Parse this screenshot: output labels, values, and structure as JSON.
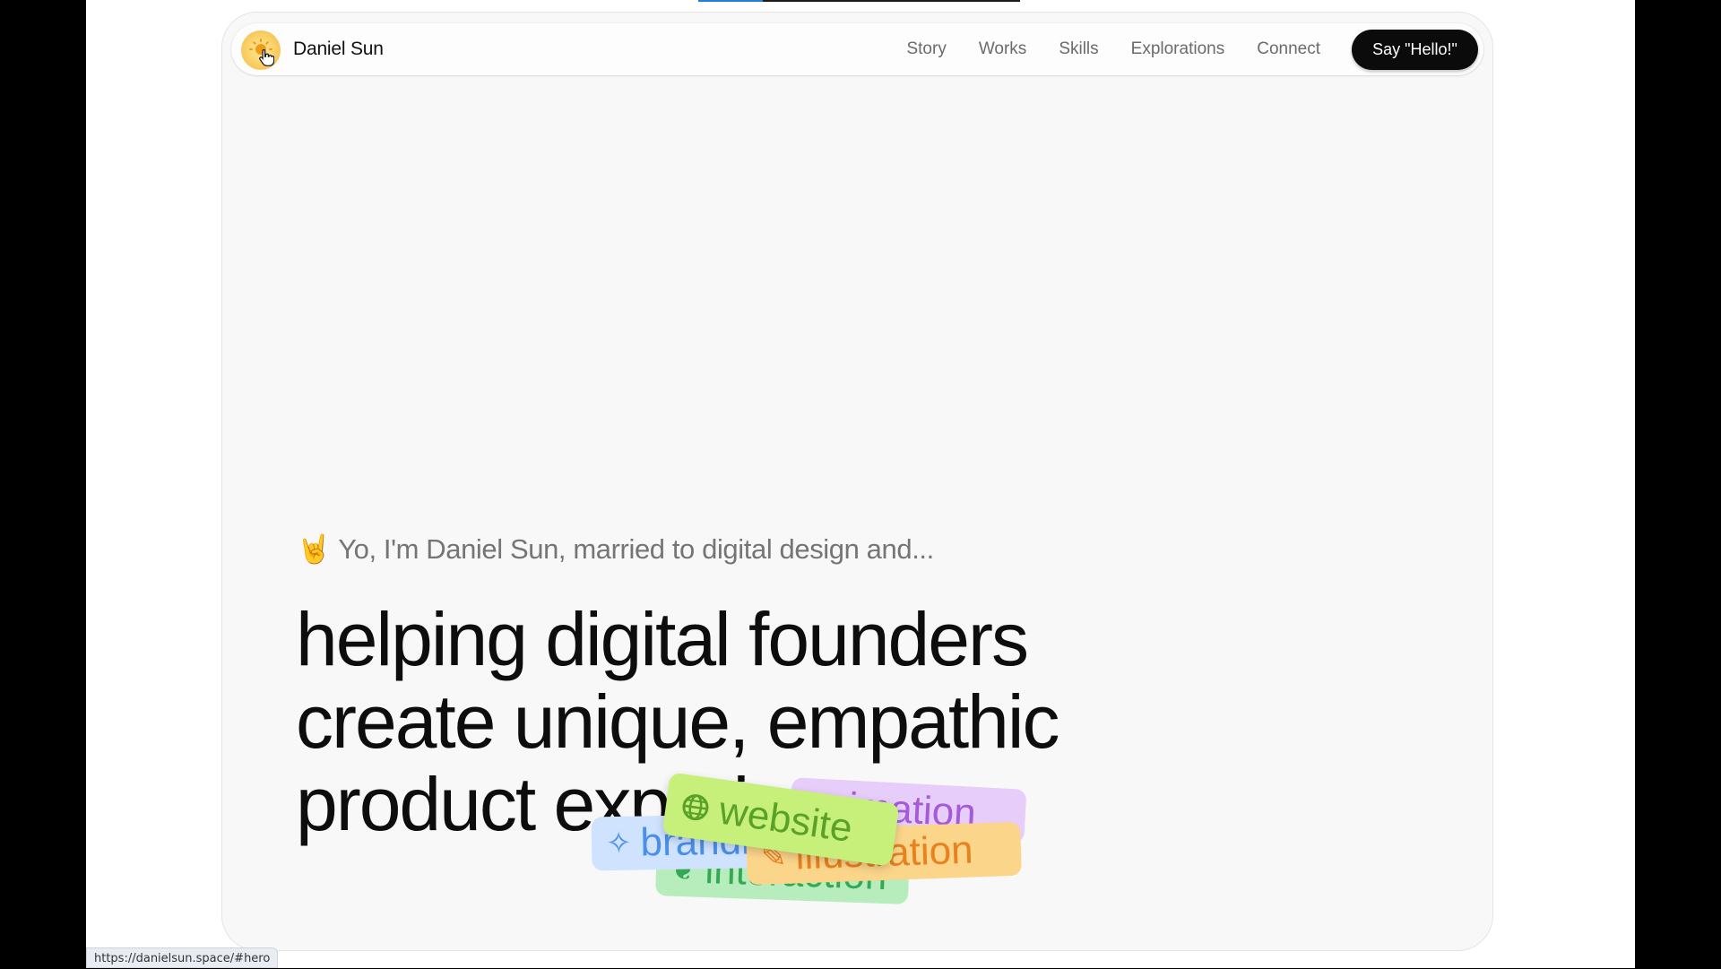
{
  "scroll_progress": 0.2,
  "header": {
    "brand_name": "Daniel Sun",
    "nav": [
      "Story",
      "Works",
      "Skills",
      "Explorations",
      "Connect"
    ],
    "cta_label": "Say \"Hello!\""
  },
  "hero": {
    "intro_emoji": "🤘",
    "intro_text": "Yo, I'm Daniel Sun, married to digital design and...",
    "headline_lines": [
      "helping digital founders",
      "create unique, empathic",
      "product experiences"
    ]
  },
  "tags": {
    "animation": "animation",
    "interaction": "interaction",
    "branding": "branding",
    "illustration": "illustration",
    "website": "website",
    "icons": {
      "branding": "sparkle-icon",
      "interaction": "leaf-icon",
      "illustration": "pen-icon",
      "website": "globe-icon"
    }
  },
  "status_bar": {
    "url": "https://danielsun.space/#hero"
  },
  "colors": {
    "cta_background": "#0b0b0b",
    "progress_fill": "#1d7fe3",
    "tag_website": "#c6f07a",
    "tag_branding": "#cfe3ff",
    "tag_illustration": "#fbd58a",
    "tag_interaction": "#b7ecbc",
    "tag_animation": "#e6cdfa"
  }
}
